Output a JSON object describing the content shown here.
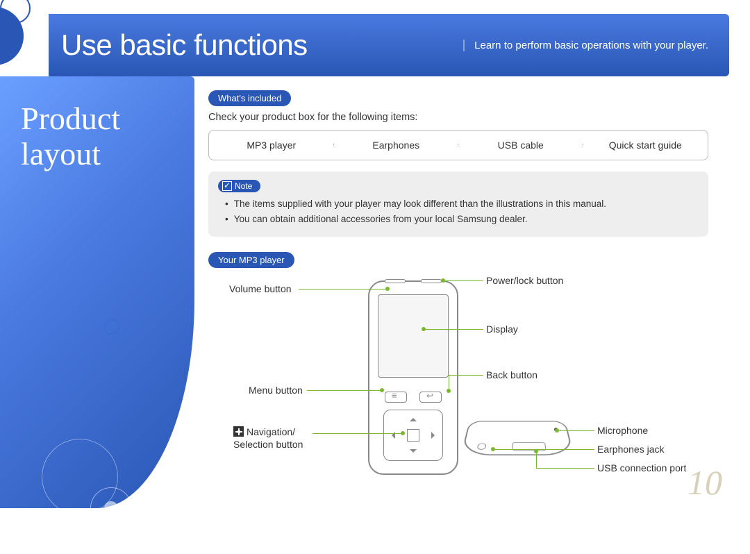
{
  "header": {
    "title": "Use basic functions",
    "subtitle": "Learn to perform basic operations with your player."
  },
  "sidebar": {
    "title_line1": "Product",
    "title_line2": "layout"
  },
  "sections": {
    "included": {
      "pill": "What's included",
      "instruction": "Check your product box for the following items:",
      "items": [
        "MP3 player",
        "Earphones",
        "USB cable",
        "Quick start guide"
      ]
    },
    "note": {
      "pill": "Note",
      "bullets": [
        "The items supplied with your player may look different than the illustrations in this manual.",
        "You can obtain additional accessories from your local Samsung dealer."
      ]
    },
    "player": {
      "pill": "Your MP3 player",
      "labels": {
        "volume": "Volume button",
        "menu": "Menu button",
        "nav1": "Navigation/",
        "nav2": "Selection button",
        "power": "Power/lock button",
        "display": "Display",
        "back": "Back button",
        "mic": "Microphone",
        "jack": "Earphones jack",
        "usb": "USB connection port"
      }
    }
  },
  "page_number": "10"
}
